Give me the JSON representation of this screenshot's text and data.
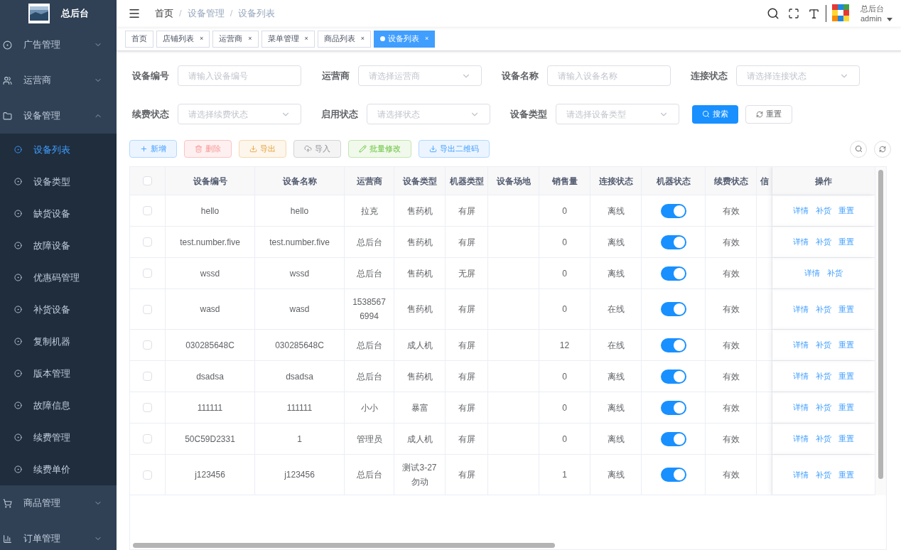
{
  "sidebar": {
    "title": "总后台",
    "items": [
      {
        "label": "广告管理",
        "expanded": false
      },
      {
        "label": "运营商",
        "expanded": false
      },
      {
        "label": "设备管理",
        "expanded": true,
        "children": [
          {
            "label": "设备列表",
            "selected": true
          },
          {
            "label": "设备类型",
            "selected": false
          },
          {
            "label": "缺货设备",
            "selected": false
          },
          {
            "label": "故障设备",
            "selected": false
          },
          {
            "label": "优惠码管理",
            "selected": false
          },
          {
            "label": "补货设备",
            "selected": false
          },
          {
            "label": "复制机器",
            "selected": false
          },
          {
            "label": "版本管理",
            "selected": false
          },
          {
            "label": "故障信息",
            "selected": false
          },
          {
            "label": "续费管理",
            "selected": false
          },
          {
            "label": "续费单价",
            "selected": false
          }
        ]
      },
      {
        "label": "商品管理",
        "expanded": false
      },
      {
        "label": "订单管理",
        "expanded": false
      }
    ]
  },
  "breadcrumb": {
    "items": [
      "首页",
      "设备管理",
      "设备列表"
    ],
    "separator": "/"
  },
  "user": {
    "org": "总后台",
    "name": "admin"
  },
  "tabs": [
    {
      "label": "首页",
      "selected": false
    },
    {
      "label": "店铺列表",
      "selected": false,
      "close": "×"
    },
    {
      "label": "运营商",
      "selected": false,
      "close": "×"
    },
    {
      "label": "菜单管理",
      "selected": false,
      "close": "×"
    },
    {
      "label": "商品列表",
      "selected": false,
      "close": "×"
    },
    {
      "label": "设备列表",
      "selected": true,
      "close": "×"
    }
  ],
  "filters": [
    {
      "label": "设备编号",
      "placeholder": "请输入设备编号",
      "kind": "input"
    },
    {
      "label": "运营商",
      "placeholder": "请选择运营商",
      "kind": "select"
    },
    {
      "label": "设备名称",
      "placeholder": "请输入设备名称",
      "kind": "input"
    },
    {
      "label": "连接状态",
      "placeholder": "请选择连接状态",
      "kind": "select"
    },
    {
      "label": "续费状态",
      "placeholder": "请选择续费状态",
      "kind": "select"
    },
    {
      "label": "启用状态",
      "placeholder": "请选择状态",
      "kind": "select"
    },
    {
      "label": "设备类型",
      "placeholder": "请选择设备类型",
      "kind": "select"
    }
  ],
  "search_button": "搜索",
  "reset_button": "重置",
  "toolbar": [
    {
      "label": "新增",
      "kind": "add"
    },
    {
      "label": "删除",
      "kind": "delete"
    },
    {
      "label": "导出",
      "kind": "export"
    },
    {
      "label": "导入",
      "kind": "import"
    },
    {
      "label": "批量修改",
      "kind": "edit"
    },
    {
      "label": "导出二维码",
      "kind": "qrcode"
    }
  ],
  "table": {
    "all_checked": false,
    "columns": [
      "设备编号",
      "设备名称",
      "运营商",
      "设备类型",
      "机器类型",
      "设备场地",
      "销售量",
      "连接状态",
      "机器状态",
      "续费状态",
      "信",
      "操作"
    ],
    "rows": [
      {
        "checked": false,
        "cells": [
          "hello",
          "hello",
          "拉克",
          "售药机",
          "有屏",
          "",
          "0",
          "离线"
        ],
        "on": true,
        "renewal": "有效",
        "actions": [
          "详情",
          "补货",
          "重置"
        ]
      },
      {
        "checked": false,
        "cells": [
          "test.number.five",
          "test.number.five",
          "总后台",
          "售药机",
          "有屏",
          "",
          "0",
          "离线"
        ],
        "on": true,
        "renewal": "有效",
        "actions": [
          "详情",
          "补货",
          "重置"
        ]
      },
      {
        "checked": false,
        "cells": [
          "wssd",
          "wssd",
          "总后台",
          "售药机",
          "无屏",
          "",
          "0",
          "离线"
        ],
        "on": true,
        "renewal": "有效",
        "actions": [
          "详情",
          "补货"
        ]
      },
      {
        "checked": false,
        "cells": [
          "wasd",
          "wasd",
          "15385676994",
          "售药机",
          "有屏",
          "",
          "0",
          "在线"
        ],
        "on": true,
        "renewal": "有效",
        "actions": [
          "详情",
          "补货",
          "重置"
        ]
      },
      {
        "checked": false,
        "cells": [
          "030285648C",
          "030285648C",
          "总后台",
          "成人机",
          "有屏",
          "",
          "12",
          "在线"
        ],
        "on": true,
        "renewal": "有效",
        "actions": [
          "详情",
          "补货",
          "重置"
        ]
      },
      {
        "checked": false,
        "cells": [
          "dsadsa",
          "dsadsa",
          "总后台",
          "售药机",
          "有屏",
          "",
          "0",
          "离线"
        ],
        "on": true,
        "renewal": "有效",
        "actions": [
          "详情",
          "补货",
          "重置"
        ]
      },
      {
        "checked": false,
        "cells": [
          "111111",
          "111111",
          "小小",
          "暴富",
          "有屏",
          "",
          "0",
          "离线"
        ],
        "on": true,
        "renewal": "有效",
        "actions": [
          "详情",
          "补货",
          "重置"
        ]
      },
      {
        "checked": false,
        "cells": [
          "50C59D2331",
          "1",
          "管理员",
          "成人机",
          "有屏",
          "",
          "0",
          "离线"
        ],
        "on": true,
        "renewal": "有效",
        "actions": [
          "详情",
          "补货",
          "重置"
        ]
      },
      {
        "checked": false,
        "cells": [
          "j123456",
          "j123456",
          "总后台",
          "测试3-27勿动",
          "有屏",
          "",
          "1",
          "离线"
        ],
        "on": true,
        "renewal": "有效",
        "actions": [
          "详情",
          "补货",
          "重置"
        ]
      }
    ]
  }
}
